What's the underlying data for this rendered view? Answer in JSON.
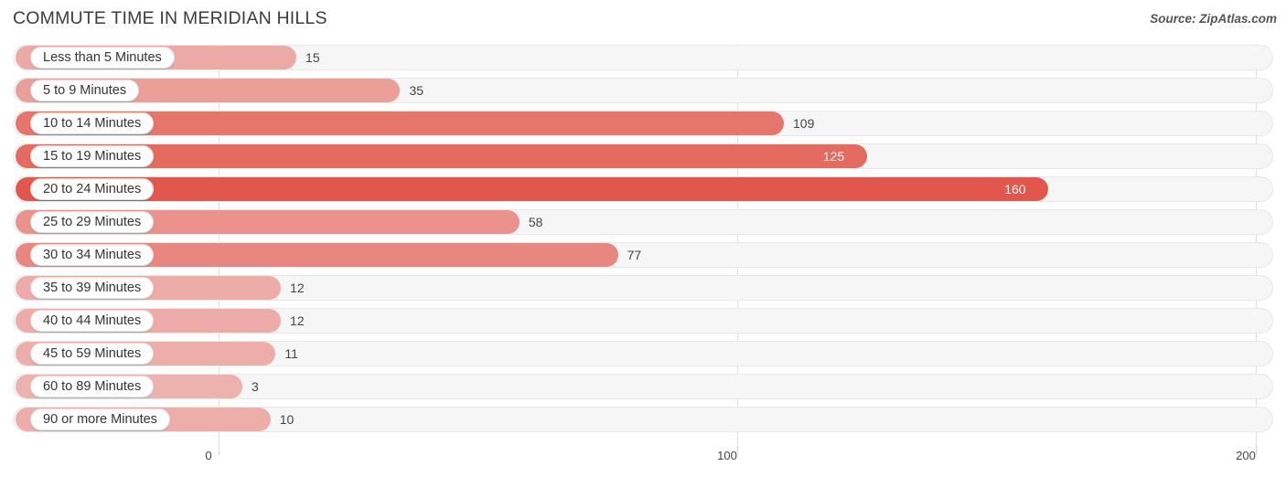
{
  "header": {
    "title": "COMMUTE TIME IN MERIDIAN HILLS",
    "source": "Source: ZipAtlas.com"
  },
  "colors": {
    "bar": "#e2574c",
    "track": "#f6f6f6",
    "grid": "#dddddd",
    "value_text": "#444444",
    "value_text_inside": "#ffffff"
  },
  "chart_data": {
    "type": "bar",
    "orientation": "horizontal",
    "title": "COMMUTE TIME IN MERIDIAN HILLS",
    "xlabel": "",
    "ylabel": "",
    "xlim": [
      0,
      200
    ],
    "xticks": [
      0,
      100,
      200
    ],
    "xtick_labels": [
      "0",
      "100",
      "200"
    ],
    "grid": true,
    "legend": false,
    "categories": [
      "Less than 5 Minutes",
      "5 to 9 Minutes",
      "10 to 14 Minutes",
      "15 to 19 Minutes",
      "20 to 24 Minutes",
      "25 to 29 Minutes",
      "30 to 34 Minutes",
      "35 to 39 Minutes",
      "40 to 44 Minutes",
      "45 to 59 Minutes",
      "60 to 89 Minutes",
      "90 or more Minutes"
    ],
    "values": [
      15,
      35,
      109,
      125,
      160,
      58,
      77,
      12,
      12,
      11,
      3,
      10
    ],
    "value_labels": [
      "15",
      "35",
      "109",
      "125",
      "160",
      "58",
      "77",
      "12",
      "12",
      "11",
      "3",
      "10"
    ]
  }
}
